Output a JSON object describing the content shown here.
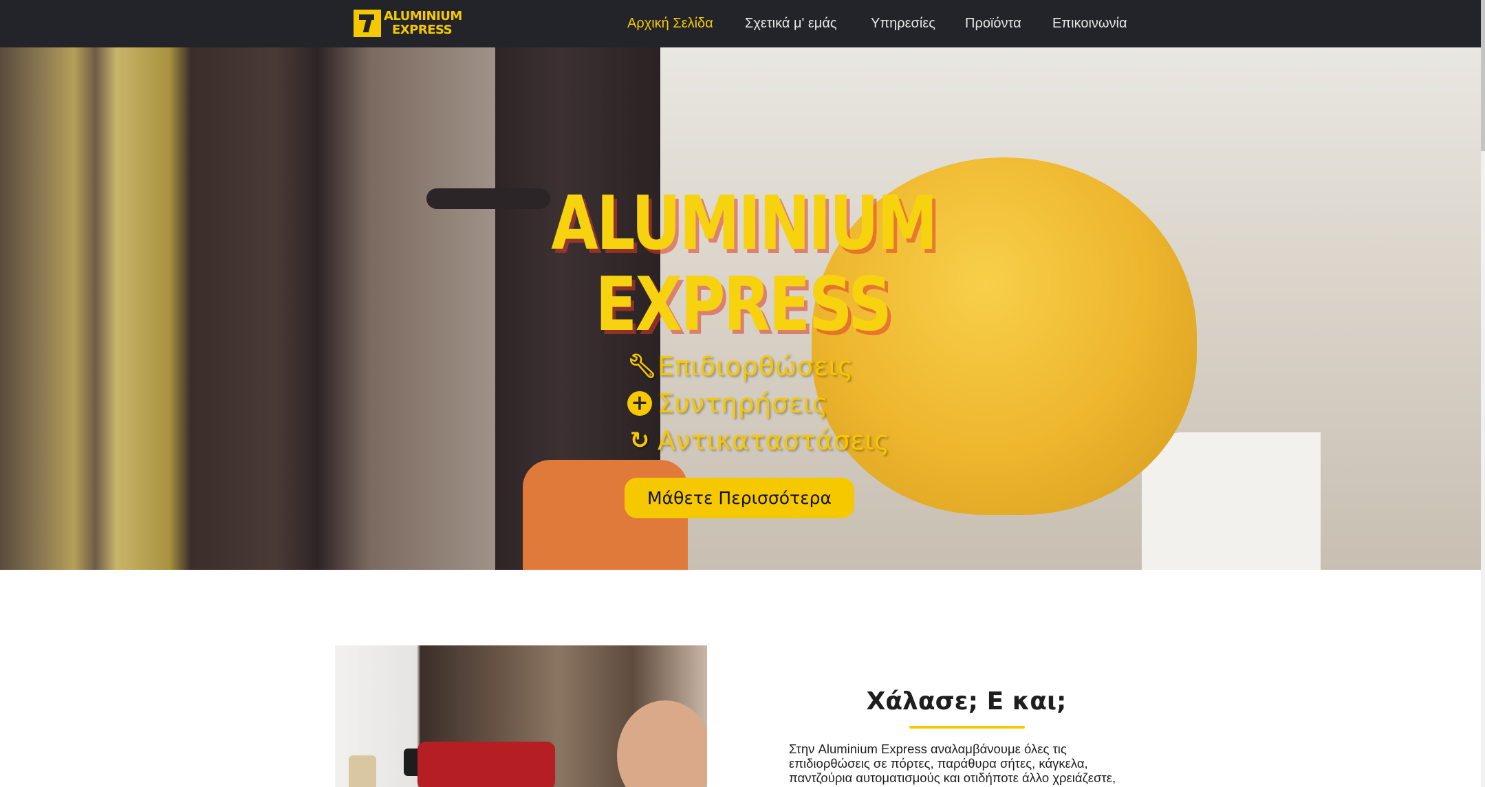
{
  "nav": {
    "logo": {
      "line1": "ALUMINIUM",
      "line2": "EXPRESS"
    },
    "links": [
      {
        "label": "Αρχική Σελίδα",
        "active": true
      },
      {
        "label": "Σχετικά μ' εμάς",
        "active": false
      },
      {
        "label": "Υπηρεσίες",
        "active": false
      },
      {
        "label": "Προϊόντα",
        "active": false
      },
      {
        "label": "Επικοινωνία",
        "active": false
      }
    ]
  },
  "hero": {
    "title_line1": "ALUMINIUM",
    "title_line2": "EXPRESS",
    "services": [
      {
        "icon": "wrench-icon",
        "label": "Επιδιορθώσεις"
      },
      {
        "icon": "plus-circle-icon",
        "label": "Συντηρήσεις"
      },
      {
        "icon": "refresh-icon",
        "label": "Αντικαταστάσεις"
      }
    ],
    "cta_label": "Μάθετε Περισσότερα"
  },
  "about": {
    "title": "Χάλασε; Ε και;",
    "text": "Στην Aluminium Express αναλαμβάνουμε όλες τις επιδιορθώσεις σε πόρτες, παράθυρα σήτες, κάγκελα, παντζούρια αυτοματισμούς και οτιδήποτε άλλο χρειάζεστε,"
  },
  "colors": {
    "accent": "#f6c800",
    "navbar": "#22242a"
  }
}
